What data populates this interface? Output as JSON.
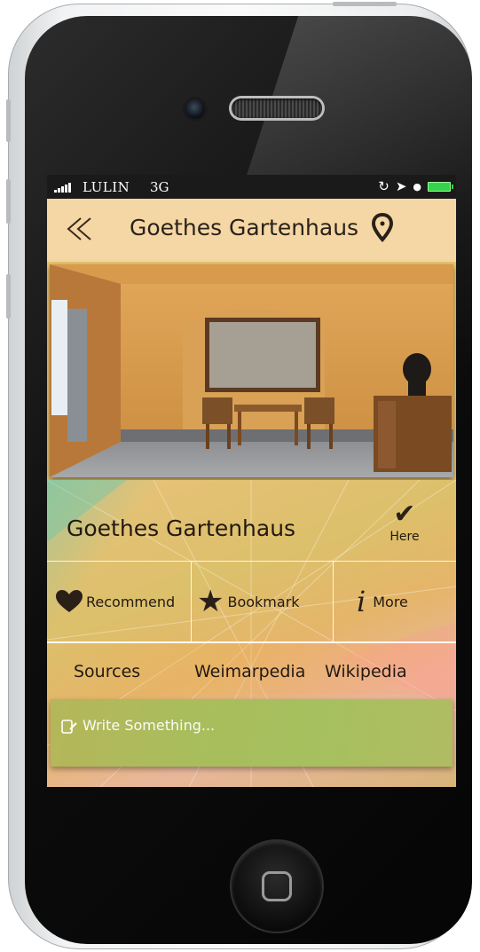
{
  "status_bar": {
    "carrier": "LULIN",
    "network": "3G"
  },
  "nav": {
    "title": "Goethes Gartenhaus",
    "back_icon": "double-chevron-left-icon",
    "location_icon": "map-pin-icon"
  },
  "place": {
    "name": "Goethes Gartenhaus",
    "here_label": "Here"
  },
  "actions": [
    {
      "label": "Recommend",
      "icon": "heart-icon"
    },
    {
      "label": "Bookmark",
      "icon": "star-icon"
    },
    {
      "label": "More",
      "icon": "info-icon"
    }
  ],
  "sources": {
    "label": "Sources",
    "links": [
      "Weimarpedia",
      "Wikipedia"
    ]
  },
  "comment": {
    "placeholder": "Write Something..."
  },
  "colors": {
    "nav_background": "#f5d7a5",
    "accent_text": "#231a12",
    "comment_box": "#a9bd5c",
    "battery": "#37d24b"
  }
}
